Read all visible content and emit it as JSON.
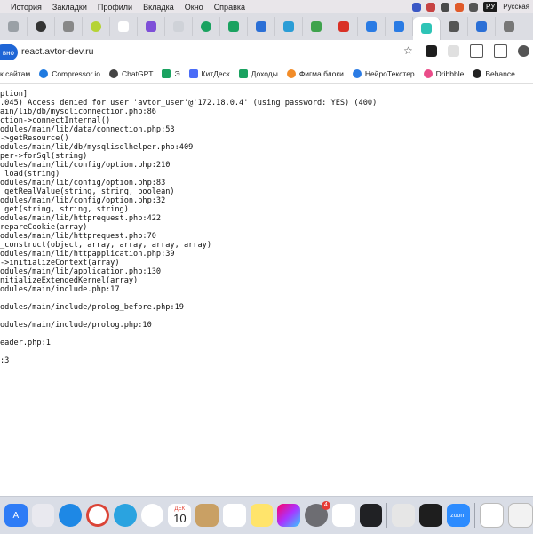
{
  "menubar": {
    "items": [
      "История",
      "Закладки",
      "Профили",
      "Вкладка",
      "Окно",
      "Справка"
    ],
    "language": "РУ",
    "language_label": "Русская"
  },
  "toolbar": {
    "site_chip": "вно",
    "url": "react.avtor-dev.ru"
  },
  "bookmarks": [
    {
      "label": "к сайтам",
      "icon": "none",
      "color": "#ffffff"
    },
    {
      "label": "Compressor.io",
      "icon": "compressor-icon",
      "color": "#1f7ae0"
    },
    {
      "label": "ChatGPT",
      "icon": "chatgpt-icon",
      "color": "#444444"
    },
    {
      "label": "Э",
      "icon": "plus-icon",
      "color": "#1aa260"
    },
    {
      "label": "КитДеск",
      "icon": "kitdesk-icon",
      "color": "#4a6cf7"
    },
    {
      "label": "Доходы",
      "icon": "plus-icon",
      "color": "#1aa260"
    },
    {
      "label": "Фигма блоки",
      "icon": "figma-icon",
      "color": "#f28c28"
    },
    {
      "label": "НейроТекстер",
      "icon": "neuro-icon",
      "color": "#2a7be4"
    },
    {
      "label": "Dribbble",
      "icon": "dribbble-icon",
      "color": "#ea4c89"
    },
    {
      "label": "Behance",
      "icon": "behance-icon",
      "color": "#222222"
    }
  ],
  "trace_lines": [
    "ption]",
    ".045) Access denied for user 'avtor_user'@'172.18.0.4' (using password: YES) (400)",
    "ain/lib/db/mysqliconnection.php:86",
    "ction->connectInternal()",
    "odules/main/lib/data/connection.php:53",
    "->getResource()",
    "odules/main/lib/db/mysqlisqlhelper.php:409",
    "per->forSql(string)",
    "odules/main/lib/config/option.php:210",
    " load(string)",
    "odules/main/lib/config/option.php:83",
    " getRealValue(string, string, boolean)",
    "odules/main/lib/config/option.php:32",
    " get(string, string, string)",
    "odules/main/lib/httprequest.php:422",
    "repareCookie(array)",
    "odules/main/lib/httprequest.php:70",
    "_construct(object, array, array, array, array)",
    "odules/main/lib/httpapplication.php:39",
    "->initializeContext(array)",
    "odules/main/lib/application.php:130",
    "nitializeExtendedKernel(array)",
    "odules/main/include.php:17",
    "",
    "odules/main/include/prolog_before.php:19",
    "",
    "odules/main/include/prolog.php:10",
    "",
    "eader.php:1",
    "",
    ":3"
  ],
  "dock": {
    "calendar_month": "ДЕК",
    "calendar_day": "10",
    "chrome_badge": "4",
    "zoom_label": "zoom"
  }
}
